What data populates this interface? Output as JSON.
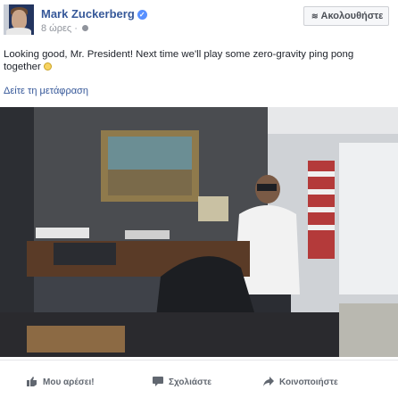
{
  "post": {
    "author": "Mark Zuckerberg",
    "time": "8 ώρες",
    "follow_label": "Ακολουθήστε",
    "text": "Looking good, Mr. President! Next time we'll play some zero-gravity ping pong together",
    "translate_label": "Δείτε τη μετάφραση"
  },
  "actions": {
    "like": "Μου αρέσει!",
    "comment": "Σχολιάστε",
    "share": "Κοινοποιήστε"
  },
  "colors": {
    "link": "#365899",
    "meta": "#90949c",
    "verified": "#5890ff"
  },
  "icons": [
    "verified-icon",
    "globe-icon",
    "rss-icon",
    "like-icon",
    "comment-icon",
    "share-icon",
    "smiley-icon"
  ]
}
